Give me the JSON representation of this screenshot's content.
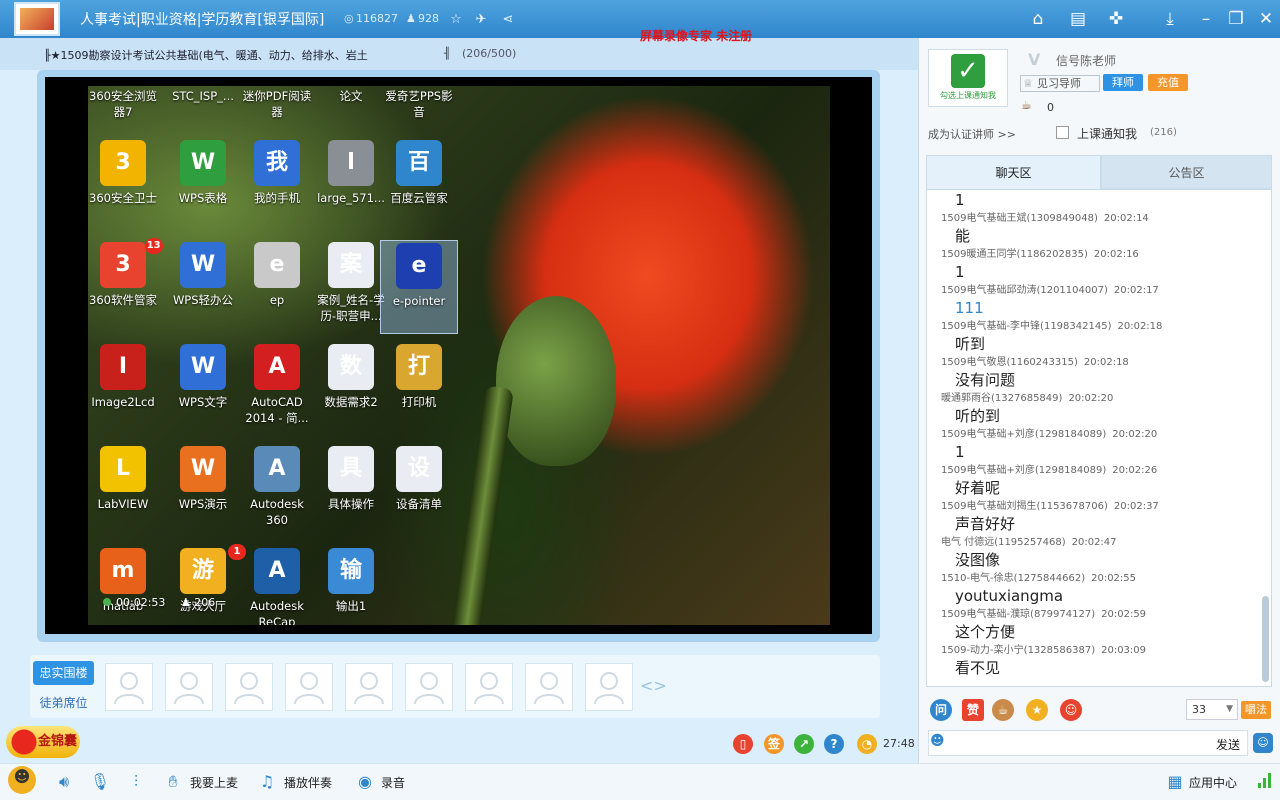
{
  "window": {
    "title": "人事考试|职业资格|学历教育[银孚国际]",
    "views": "116827",
    "members": "928",
    "watermark": "屏幕录像专家 未注册"
  },
  "course": {
    "name": "╟★1509勘察设计考试公共基础(电气、暖通、动力、给排水、岩土",
    "divider": "╢",
    "count": "(206/500)"
  },
  "desktop_icons": [
    {
      "label": "360安全浏览器7",
      "icon": "browser-icon"
    },
    {
      "label": "STC_ISP_...",
      "icon": "chip-icon"
    },
    {
      "label": "迷你PDF阅读器",
      "icon": "pdf-icon"
    },
    {
      "label": "论文",
      "icon": "folder-icon"
    },
    {
      "label": "爱奇艺PPS影音",
      "icon": "video-icon"
    },
    {
      "label": "360安全卫士",
      "icon": "shield-plus-icon",
      "color": "#f2b400"
    },
    {
      "label": "WPS表格",
      "icon": "spreadsheet-icon",
      "color": "#2e9e3e"
    },
    {
      "label": "我的手机",
      "icon": "phone-icon",
      "color": "#2f6fd6"
    },
    {
      "label": "large_571...",
      "icon": "image-file-icon",
      "color": "#8a8f96"
    },
    {
      "label": "百度云管家",
      "icon": "cloud-icon",
      "color": "#2f86cc"
    },
    {
      "label": "360软件管家",
      "icon": "apps-icon",
      "color": "#e8432e",
      "badge": "13"
    },
    {
      "label": "WPS轻办公",
      "icon": "office-icon",
      "color": "#2f6fd6"
    },
    {
      "label": "ep",
      "icon": "film-icon",
      "color": "#c9c9c9"
    },
    {
      "label": "案例_姓名-学历-职营申...",
      "icon": "word-doc-icon",
      "color": "#e9edf3"
    },
    {
      "label": "e-pointer",
      "icon": "pen-pointer-icon",
      "color": "#1e3fb0"
    },
    {
      "label": "Image2Lcd",
      "icon": "lcd-icon",
      "color": "#c8201a"
    },
    {
      "label": "WPS文字",
      "icon": "wps-writer-icon",
      "color": "#2f6fd6"
    },
    {
      "label": "AutoCAD 2014 - 简...",
      "icon": "autocad-icon",
      "color": "#d31f1f"
    },
    {
      "label": "数据需求2",
      "icon": "word-doc-icon",
      "color": "#e9edf3"
    },
    {
      "label": "打印机",
      "icon": "printer-folder-icon",
      "color": "#d9a630"
    },
    {
      "label": "LabVIEW",
      "icon": "labview-icon",
      "color": "#f2c200"
    },
    {
      "label": "WPS演示",
      "icon": "presentation-icon",
      "color": "#e9701f"
    },
    {
      "label": "Autodesk 360",
      "icon": "autodesk360-icon",
      "color": "#5a8ab8"
    },
    {
      "label": "具体操作",
      "icon": "word-doc-icon",
      "color": "#e9edf3"
    },
    {
      "label": "设备清单",
      "icon": "word-doc-icon",
      "color": "#e9edf3"
    },
    {
      "label": "matlab",
      "icon": "matlab-icon",
      "color": "#e8611a"
    },
    {
      "label": "游戏大厅",
      "icon": "game-icon",
      "color": "#f0b020",
      "badge": "1"
    },
    {
      "label": "Autodesk ReCap",
      "icon": "recap-icon",
      "color": "#1e5fa8"
    },
    {
      "label": "输出1",
      "icon": "output-icon",
      "color": "#3a8ad6"
    }
  ],
  "video": {
    "elapsed": "00:02:53",
    "viewers": "206"
  },
  "seats": {
    "tab1": "忠实围楼",
    "tab2": "徒弟席位",
    "arrows": "<>"
  },
  "toolbar": {
    "promo": "金锦囊",
    "time_left": "27:48",
    "mic_up": "我要上麦",
    "play_music": "播放伴奏",
    "record": "录音",
    "app_center": "应用中心"
  },
  "teacher": {
    "name": "信号陈老师",
    "avatar_caption": "勾选上课通知我",
    "level": "见习导师",
    "follow_label": "拜师",
    "recharge_label": "充值",
    "cups": "0",
    "become_lecturer": "成为认证讲师 >>",
    "notify_label": "上课通知我",
    "notify_count": "(216)"
  },
  "tabs": {
    "chat": "聊天区",
    "notice": "公告区"
  },
  "chat": [
    {
      "text": "1",
      "sender": "1509电气基础王斌(1309849048)",
      "time": "20:02:14"
    },
    {
      "text": "能",
      "sender": "1509暖通王同学(1186202835)",
      "time": "20:02:16"
    },
    {
      "text": "1",
      "sender": "1509电气基础邱劲涛(1201104007)",
      "time": "20:02:17"
    },
    {
      "text": "111",
      "sender": "1509电气基础-李中锋(1198342145)",
      "time": "20:02:18",
      "blue": true
    },
    {
      "text": "听到",
      "sender": "1509电气敬恩(1160243315)",
      "time": "20:02:18"
    },
    {
      "text": "没有问题",
      "sender": "暖通郭雨谷(1327685849)",
      "time": "20:02:20"
    },
    {
      "text": "听的到",
      "sender": "1509电气基础+刘彦(1298184089)",
      "time": "20:02:20"
    },
    {
      "text": "1",
      "sender": "1509电气基础+刘彦(1298184089)",
      "time": "20:02:26"
    },
    {
      "text": "好着呢",
      "sender": "1509电气基础刘揭生(1153678706)",
      "time": "20:02:37"
    },
    {
      "text": "声音好好",
      "sender": "电气 付德远(1195257468)",
      "time": "20:02:47"
    },
    {
      "text": "没图像",
      "sender": "1510-电气-徐忠(1275844662)",
      "time": "20:02:55"
    },
    {
      "text": "youtuxiangma",
      "sender": "1509电气基础-濮琼(879974127)",
      "time": "20:02:59"
    },
    {
      "text": "这个方便",
      "sender": "1509-动力-栾小宁(1328586387)",
      "time": "20:03:09"
    },
    {
      "text": "看不见",
      "sender": "",
      "time": ""
    }
  ],
  "chat_tools": {
    "font_size": "33",
    "broadcast": "嚼法",
    "send": "发送"
  }
}
